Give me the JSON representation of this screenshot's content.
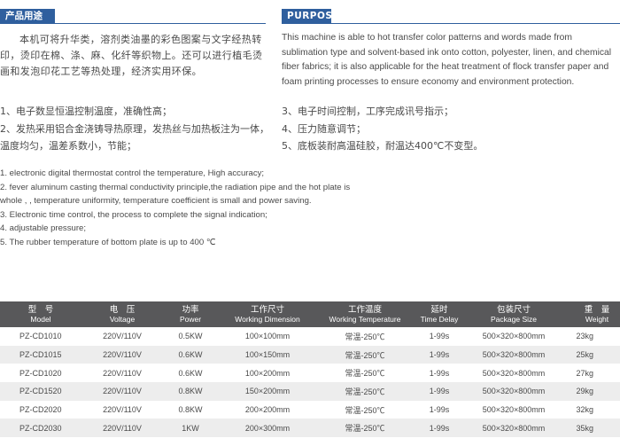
{
  "cn_section": {
    "heading": "产品用途",
    "intro": "本机可将升华类，溶剂类油墨的彩色图案与文字经热转印，烫印在棉、涤、麻、化纤等织物上。还可以进行植毛烫画和发泡印花工艺等热处理，经济实用环保。",
    "features_left": [
      "1、电子数显恒温控制温度，准确性高；",
      "2、发热采用铝合金浇铸导热原理，发热丝与加热板注为一体，温度均匀，温差系数小，节能；"
    ],
    "features_right": [
      "3、电子时间控制，工序完成讯号指示；",
      "4、压力随意调节；",
      "5、底板装耐高温硅胶，耐温达400℃不变型。"
    ]
  },
  "en_section": {
    "heading": "PURPOSE",
    "intro": "This machine is able to hot transfer color patterns and words made from sublimation type and solvent-based ink onto cotton, polyester, linen, and chemical fiber fabrics; it is also applicable for the heat treatment of flock transfer paper and foam printing processes to ensure economy and environment protection."
  },
  "features_en": [
    "1. electronic digital thermostat control the temperature, High accuracy;",
    "2. fever  aluminum casting thermal conductivity principle,the radiation pipe and the hot plate is",
    "whole , , temperature uniformity, temperature coefficient is small and power saving.",
    "3. Electronic time control, the process to complete the signal indication;",
    "4. adjustable pressure;",
    "5. The  rubber temperature  of bottom plate is up to 400 ℃"
  ],
  "table": {
    "headers": [
      {
        "cn": "型　号",
        "en": "Model"
      },
      {
        "cn": "电　压",
        "en": "Voltage"
      },
      {
        "cn": "功率",
        "en": "Power"
      },
      {
        "cn": "工作尺寸",
        "en": "Working Dimension"
      },
      {
        "cn": "工作温度",
        "en": "Working Temperature"
      },
      {
        "cn": "延时",
        "en": "Time Delay"
      },
      {
        "cn": "包装尺寸",
        "en": "Package Size"
      },
      {
        "cn": "重　量",
        "en": "Weight"
      }
    ],
    "rows": [
      {
        "model": "PZ-CD1010",
        "voltage": "220V/110V",
        "power": "0.5KW",
        "dimension": "100×100mm",
        "temperature": "常温-250℃",
        "delay": "1-99s",
        "package": "500×320×800mm",
        "weight": "23kg"
      },
      {
        "model": "PZ-CD1015",
        "voltage": "220V/110V",
        "power": "0.6KW",
        "dimension": "100×150mm",
        "temperature": "常温-250℃",
        "delay": "1-99s",
        "package": "500×320×800mm",
        "weight": "25kg"
      },
      {
        "model": "PZ-CD1020",
        "voltage": "220V/110V",
        "power": "0.6KW",
        "dimension": "100×200mm",
        "temperature": "常温-250℃",
        "delay": "1-99s",
        "package": "500×320×800mm",
        "weight": "27kg"
      },
      {
        "model": "PZ-CD1520",
        "voltage": "220V/110V",
        "power": "0.8KW",
        "dimension": "150×200mm",
        "temperature": "常温-250℃",
        "delay": "1-99s",
        "package": "500×320×800mm",
        "weight": "29kg"
      },
      {
        "model": "PZ-CD2020",
        "voltage": "220V/110V",
        "power": "0.8KW",
        "dimension": "200×200mm",
        "temperature": "常温-250℃",
        "delay": "1-99s",
        "package": "500×320×800mm",
        "weight": "32kg"
      },
      {
        "model": "PZ-CD2030",
        "voltage": "220V/110V",
        "power": "1KW",
        "dimension": "200×300mm",
        "temperature": "常温-250℃",
        "delay": "1-99s",
        "package": "500×320×800mm",
        "weight": "35kg"
      }
    ]
  },
  "colors": {
    "heading_bg": "#2f5f9e",
    "table_header_bg": "#58585a",
    "table_row_alt": "#ededed",
    "text": "#4a4a4a"
  }
}
